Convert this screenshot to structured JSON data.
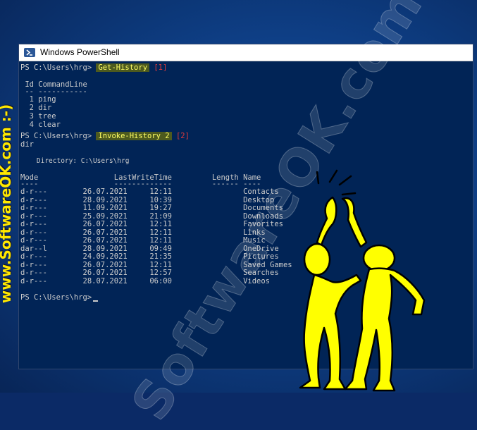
{
  "side_text": "www.SoftwareOK.com :-)",
  "watermark": "SoftwareOK.com",
  "window": {
    "title": "Windows PowerShell",
    "icon": "powershell-icon"
  },
  "console": {
    "prompt": "PS C:\\Users\\hrg>",
    "cmd1": "Get-History",
    "tag1": "[1]",
    "history_header": " Id CommandLine",
    "history_sep": " -- -----------",
    "history": [
      "  1 ping",
      "  2 dir",
      "  3 tree",
      "  4 clear"
    ],
    "cmd2": "Invoke-History 2",
    "tag2": "[2]",
    "echo": "dir",
    "directory_line": "    Directory: C:\\Users\\hrg",
    "table_header": "Mode                 LastWriteTime         Length Name",
    "table_sep": "----                 -------------         ------ ----",
    "rows": [
      "d-r---        26.07.2021     12:11                Contacts",
      "d-r---        28.09.2021     10:39                Desktop",
      "d-r---        11.09.2021     19:27                Documents",
      "d-r---        25.09.2021     21:09                Downloads",
      "d-r---        26.07.2021     12:11                Favorites",
      "d-r---        26.07.2021     12:11                Links",
      "d-r---        26.07.2021     12:11                Music",
      "dar--l        28.09.2021     09:49                OneDrive",
      "d-r---        24.09.2021     21:35                Pictures",
      "d-r---        26.07.2021     12:11                Saved Games",
      "d-r---        26.07.2021     12:57                Searches",
      "d-r---        28.07.2021     06:00                Videos"
    ]
  },
  "colors": {
    "console_bg": "#012456",
    "text": "#cccccc",
    "highlight": "#4d5a1e",
    "tag": "#e03a3a",
    "figure": "#ffff00"
  }
}
